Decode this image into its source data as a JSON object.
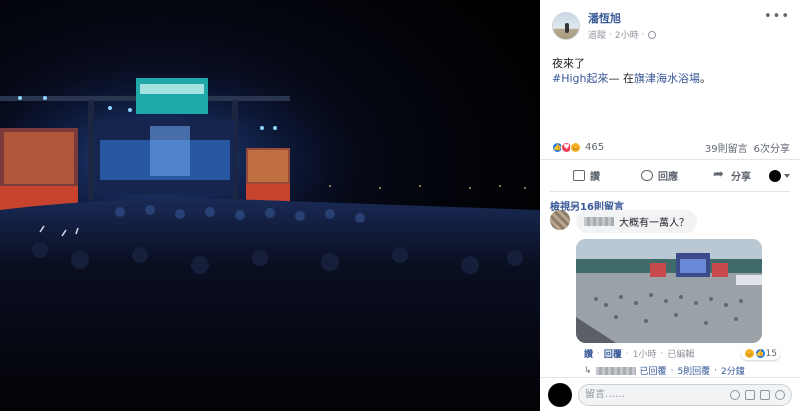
{
  "post": {
    "author": "潘恆旭",
    "follow_label": "追蹤",
    "separator": "·",
    "time": "2小時",
    "text_line1": "夜來了",
    "hashtag": "#High起來",
    "dash": "— 在",
    "place": "旗津海水浴場",
    "place_end": "。",
    "reaction_count": "465",
    "comments_count": "39則留言",
    "shares_count": "6次分享"
  },
  "actions": {
    "like": "讚",
    "comment": "回應",
    "share": "分享"
  },
  "comments": {
    "view_more": "檢視另16則留言",
    "first": {
      "text": "大概有一萬人？",
      "reply_label": "回覆",
      "dot": "·",
      "time": "1小時",
      "edited": "已編輯",
      "reaction_count": "15",
      "like_label": "讚"
    },
    "reply_preview": {
      "label": "已回覆",
      "dot": "·",
      "count": "5則回覆",
      "time": "2分鐘"
    }
  },
  "composer": {
    "placeholder": "留言……"
  },
  "icons": {
    "more": "more-icon",
    "globe": "globe-icon",
    "like_reaction": "like-reaction-icon",
    "love_reaction": "love-reaction-icon",
    "haha_reaction": "haha-reaction-icon"
  },
  "colors": {
    "link": "#385898",
    "muted": "#606770",
    "like": "#1877f2",
    "love": "#f33e58",
    "haha": "#f7b125"
  }
}
